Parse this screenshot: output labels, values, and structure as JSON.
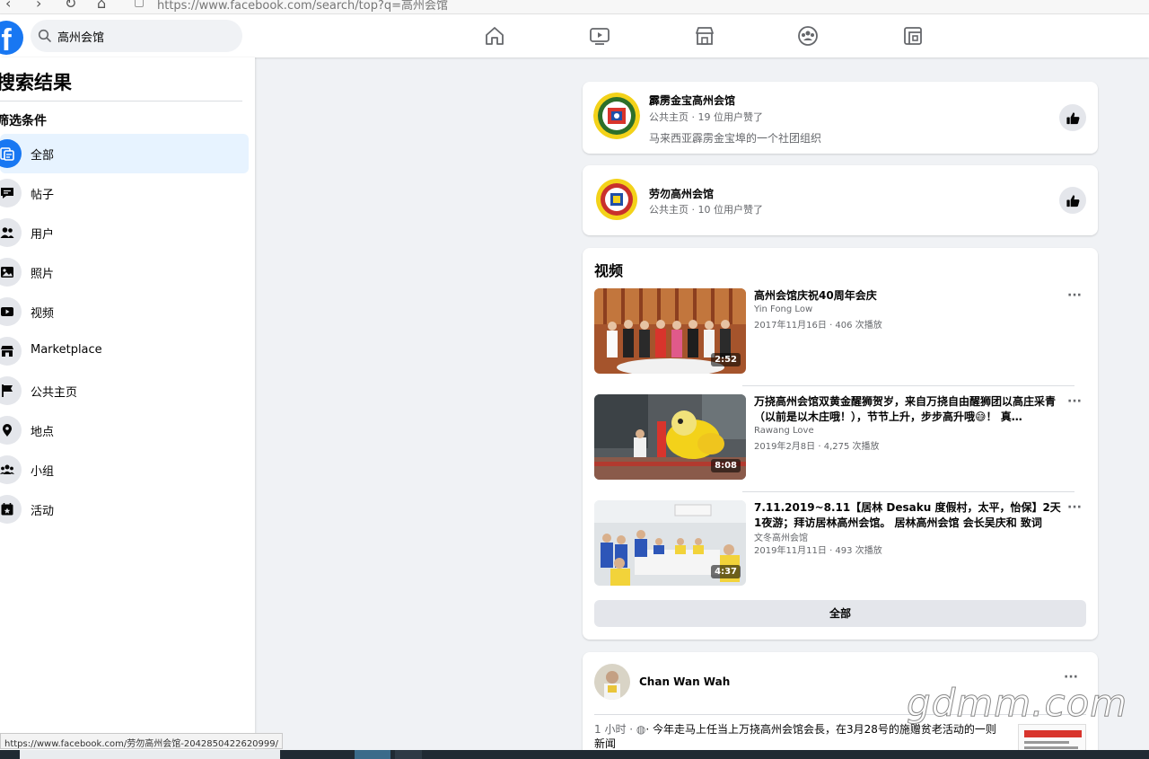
{
  "browser": {
    "url": "https://www.facebook.com/search/top?q=高州会馆"
  },
  "topnav": {
    "logo": "f",
    "search_value": "高州会馆"
  },
  "sidebar": {
    "title": "搜索结果",
    "filter_title": "筛选条件",
    "items": [
      {
        "label": "全部",
        "active": true
      },
      {
        "label": "帖子"
      },
      {
        "label": "用户"
      },
      {
        "label": "照片"
      },
      {
        "label": "视频"
      },
      {
        "label": "Marketplace"
      },
      {
        "label": "公共主页"
      },
      {
        "label": "地点"
      },
      {
        "label": "小组"
      },
      {
        "label": "活动"
      }
    ]
  },
  "status_url": "https://www.facebook.com/劳勿高州会馆-2042850422620999/",
  "pages": [
    {
      "name": "霹雳金宝高州会馆",
      "meta": "公共主页 · 19 位用户赞了",
      "description": "马来西亚霹雳金宝埠的一个社团组织"
    },
    {
      "name": "劳勿高州会馆",
      "meta": "公共主页 · 10 位用户赞了"
    }
  ],
  "videos": {
    "title": "视频",
    "items": [
      {
        "title": "高州会馆庆祝40周年会庆",
        "author": "Yin Fong Low",
        "meta": "2017年11月16日 · 406 次播放",
        "duration": "2:52"
      },
      {
        "title": "万挠高州会馆双黄金醒狮贺岁，来自万挠自由醒狮团以高庄采青（以前是以木庄哦！），节节上升，步步高升哦😅！ 真…",
        "author": "Rawang Love",
        "meta": "2019年2月8日 · 4,275 次播放",
        "duration": "8:08"
      },
      {
        "title": "7.11.2019~8.11【居林 Desaku 度假村，太平，怡保】2天1夜游；拜访居林高州会馆。 居林高州会馆 会长吴庆和 致词",
        "author": "文冬高州会馆",
        "meta": "2019年11月11日 · 493 次播放",
        "duration": "4:37"
      }
    ],
    "see_all": "全部",
    "more": "···"
  },
  "post": {
    "author": "Chan Wan Wah",
    "time": "1 小时 · ",
    "text": "· 今年走马上任当上万挠高州会馆会長，在3月28号的施赠贫老活动的一则新闻",
    "more": "···"
  },
  "watermark": "gdmm.com",
  "colors": {
    "brand": "#1877f2",
    "page_bg": "#f0f2f5",
    "active_bg": "#e7f3ff"
  }
}
